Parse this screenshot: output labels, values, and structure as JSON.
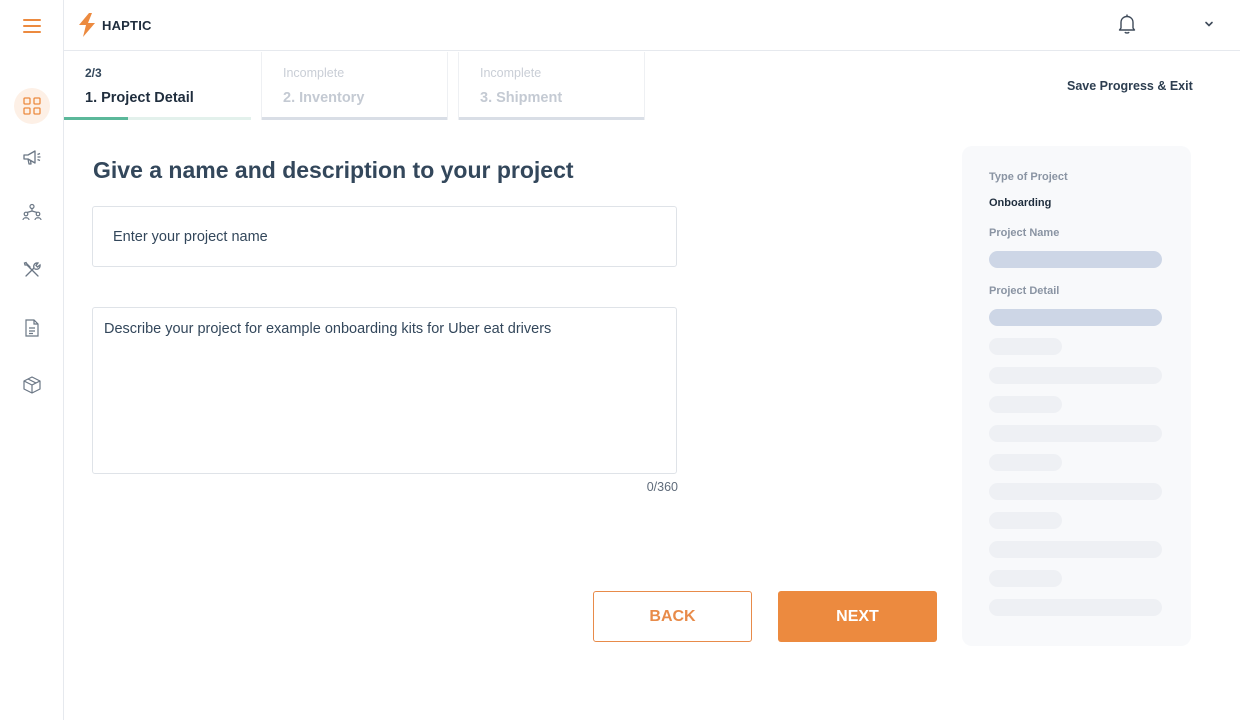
{
  "app": {
    "name": "HAPTIC"
  },
  "sidebar": {
    "items": [
      {
        "name": "dashboard",
        "icon": "grid-icon",
        "active": true
      },
      {
        "name": "campaigns",
        "icon": "megaphone-icon",
        "active": false
      },
      {
        "name": "recipients",
        "icon": "people-network-icon",
        "active": false
      },
      {
        "name": "tools",
        "icon": "tools-icon",
        "active": false
      },
      {
        "name": "documents",
        "icon": "document-icon",
        "active": false
      },
      {
        "name": "inventory",
        "icon": "box-icon",
        "active": false
      }
    ]
  },
  "stepper": {
    "steps": [
      {
        "status": "2/3",
        "title": "1. Project Detail",
        "state": "active"
      },
      {
        "status": "Incomplete",
        "title": "2. Inventory",
        "state": "inactive"
      },
      {
        "status": "Incomplete",
        "title": "3. Shipment",
        "state": "inactive"
      }
    ],
    "progress": 0.33
  },
  "header": {
    "save_exit": "Save Progress & Exit"
  },
  "form": {
    "heading": "Give a name and description to your project",
    "name_placeholder": "Enter your project name",
    "description_placeholder": "Describe your project for example onboarding kits for Uber eat drivers",
    "counter": "0/360"
  },
  "actions": {
    "back": "BACK",
    "next": "NEXT"
  },
  "summary": {
    "type_label": "Type of Project",
    "type_value": "Onboarding",
    "name_label": "Project Name",
    "detail_label": "Project Detail"
  },
  "colors": {
    "accent": "#ec8a3f",
    "progress": "#5bb89a",
    "text": "#33475b"
  }
}
